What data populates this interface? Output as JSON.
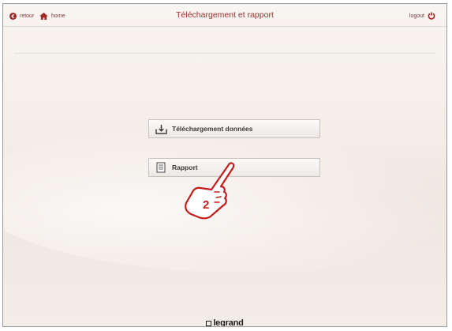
{
  "header": {
    "back_label": "retour",
    "home_label": "home",
    "title": "Téléchargement et rapport",
    "logout_label": "logout"
  },
  "menu": {
    "download_label": "Téléchargement données",
    "report_label": "Rapport"
  },
  "callout": {
    "step_number": "2"
  },
  "footer": {
    "brand": "legrand"
  },
  "colors": {
    "accent": "#a03030",
    "background": "#f4eee9"
  },
  "icons": {
    "back": "back-arrow-circle-icon",
    "home": "home-icon",
    "logout": "power-icon",
    "download": "download-tray-icon",
    "report": "document-icon",
    "hand": "pointing-hand-icon"
  }
}
